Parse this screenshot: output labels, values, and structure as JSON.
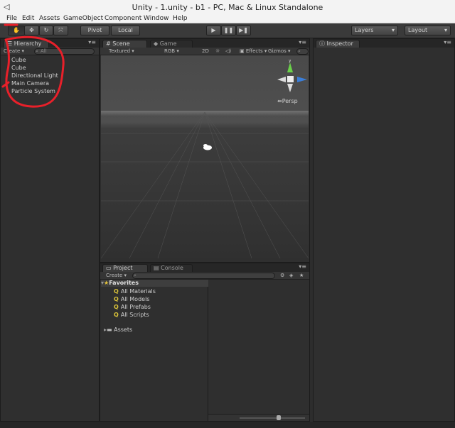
{
  "window": {
    "title": "Unity - 1.unity - b1 - PC, Mac & Linux Standalone",
    "icon": "unity-logo-icon"
  },
  "menu": [
    "File",
    "Edit",
    "Assets",
    "GameObject",
    "Component",
    "Window",
    "Help"
  ],
  "toolbar": {
    "tools": [
      {
        "name": "hand-tool-icon",
        "glyph": "✋"
      },
      {
        "name": "move-tool-icon",
        "glyph": "✥"
      },
      {
        "name": "rotate-tool-icon",
        "glyph": "↻"
      },
      {
        "name": "scale-tool-icon",
        "glyph": "⤧"
      }
    ],
    "pivot_label": "Pivot",
    "local_label": "Local",
    "play_glyph": "▶",
    "pause_glyph": "❚❚",
    "step_glyph": "▶❚",
    "layers_label": "Layers",
    "layout_label": "Layout"
  },
  "hierarchy": {
    "tab_label": "Hierarchy",
    "create_label": "Create",
    "search_placeholder": "All",
    "items": [
      "Cube",
      "Cube",
      "Directional Light",
      "Main Camera",
      "Particle System"
    ]
  },
  "scene": {
    "tabs": [
      "Scene",
      "Game"
    ],
    "shading_mode": "Textured",
    "render_mode": "RGB",
    "dimension": "2D",
    "effects_label": "Effects",
    "gizmos_label": "Gizmos",
    "search_placeholder": "All",
    "persp_label": "Persp",
    "gizmo_axes": {
      "y": "y",
      "z": "z"
    }
  },
  "inspector": {
    "tab_label": "Inspector"
  },
  "project": {
    "tabs": [
      "Project",
      "Console"
    ],
    "create_label": "Create",
    "favorites_label": "Favorites",
    "favorites": [
      "All Materials",
      "All Models",
      "All Prefabs",
      "All Scripts"
    ],
    "assets_label": "Assets"
  },
  "colors": {
    "annotation": "#e8202a",
    "favorite_star": "#e8c53a",
    "gizmo_y": "#6bd24a",
    "gizmo_z": "#3b7ed8"
  }
}
